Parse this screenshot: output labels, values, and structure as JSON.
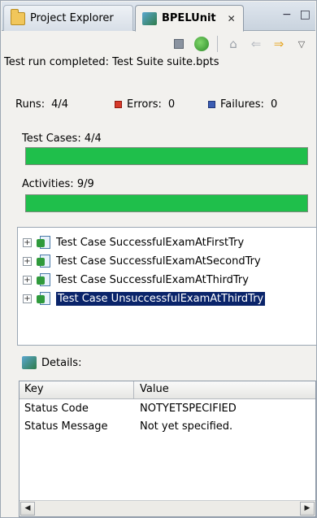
{
  "tabs": {
    "explorer_label": "Project Explorer",
    "bpel_label": "BPELUnit",
    "close_glyph": "✕"
  },
  "window_buttons": {
    "minimize": "−",
    "maximize": "□"
  },
  "toolbar": {
    "icons": [
      "stop-icon",
      "run-icon",
      "home-icon",
      "back-arrow-icon",
      "forward-arrow-icon",
      "view-menu-icon"
    ]
  },
  "summary": {
    "status": "Test run completed: Test Suite suite.bpts",
    "runs_label": "Runs:",
    "runs_value": "4/4",
    "errors_label": "Errors:",
    "errors_value": "0",
    "failures_label": "Failures:",
    "failures_value": "0",
    "test_cases_label": "Test Cases: 4/4",
    "test_cases_progress": 1.0,
    "activities_label": "Activities: 9/9",
    "activities_progress": 1.0,
    "bar_color": "#1fbf4b"
  },
  "tree": {
    "items": [
      {
        "label": "Test Case SuccessfulExamAtFirstTry",
        "expander": "+"
      },
      {
        "label": "Test Case SuccessfulExamAtSecondTry",
        "expander": "+"
      },
      {
        "label": "Test Case SuccessfulExamAtThirdTry",
        "expander": "+"
      },
      {
        "label": "Test Case UnsuccessfulExamAtThirdTry",
        "expander": "+"
      }
    ],
    "selected_index": 3
  },
  "details": {
    "title": "Details:",
    "columns": [
      "Key",
      "Value"
    ],
    "rows": [
      {
        "key": "Status Code",
        "value": "NOTYETSPECIFIED"
      },
      {
        "key": "Status Message",
        "value": "Not yet specified."
      }
    ],
    "scroll_left": "◀",
    "scroll_right": "▶"
  }
}
